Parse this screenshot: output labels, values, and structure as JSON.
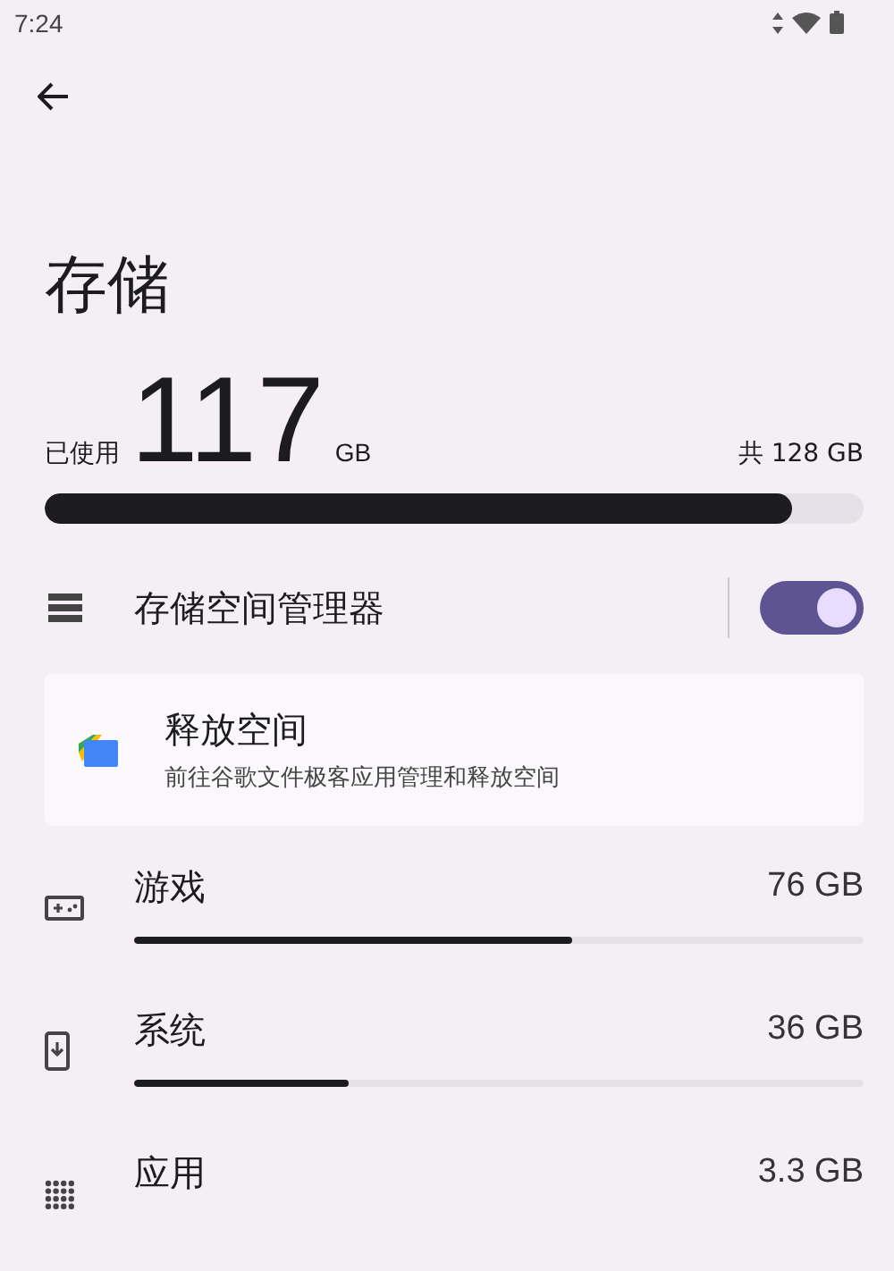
{
  "status_bar": {
    "time": "7:24"
  },
  "title": "存储",
  "usage": {
    "used_label": "已使用",
    "used_value": "117",
    "used_unit": "GB",
    "total": "共 128 GB",
    "level": 0.913
  },
  "manager": {
    "label": "存储空间管理器",
    "on": true
  },
  "free_up": {
    "title": "释放空间",
    "subtitle": "前往谷歌文件极客应用管理和释放空间"
  },
  "categories": [
    {
      "kind": "games",
      "name": "游戏",
      "size": "76 GB",
      "level": 0.6
    },
    {
      "kind": "system",
      "name": "系统",
      "size": "36 GB",
      "level": 0.295
    },
    {
      "kind": "apps",
      "name": "应用",
      "size": "3.3 GB"
    }
  ]
}
